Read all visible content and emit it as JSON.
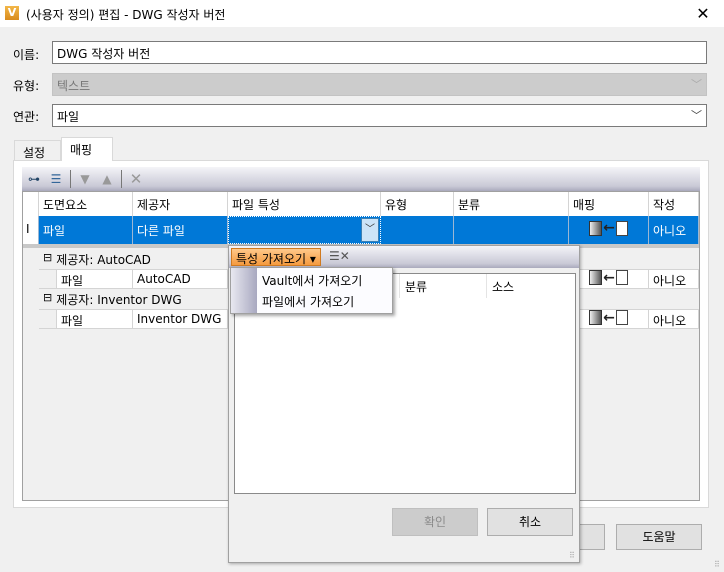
{
  "window": {
    "title": "(사용자 정의) 편집 - DWG 작성자 버전",
    "icon": "V",
    "close": "✕"
  },
  "form": {
    "name_label": "이름:",
    "name_value": "DWG 작성자 버전",
    "type_label": "유형:",
    "type_value": "텍스트",
    "assoc_label": "연관:",
    "assoc_value": "파일"
  },
  "tabs": [
    {
      "label": "설정"
    },
    {
      "label": "매핑"
    }
  ],
  "grid": {
    "headers": [
      "도면요소",
      "제공자",
      "파일 특성",
      "유형",
      "분류",
      "매핑",
      "작성"
    ],
    "selected_row": {
      "indicator": "I",
      "element": "파일",
      "provider": "다른 파일",
      "property": "",
      "type": "",
      "category": "",
      "write": "아니오"
    },
    "groups": [
      {
        "label": "제공자: AutoCAD",
        "row": {
          "element": "파일",
          "provider": "AutoCAD",
          "write": "아니오"
        }
      },
      {
        "label": "제공자: Inventor DWG",
        "row": {
          "element": "파일",
          "provider": "Inventor DWG",
          "write": "아니오"
        }
      }
    ]
  },
  "popup": {
    "get_button": "특성 가져오기 ▾",
    "columns": [
      "분류",
      "소스"
    ],
    "menu": [
      "Vault에서 가져오기",
      "파일에서 가져오기"
    ],
    "ok": "확인",
    "cancel": "취소"
  },
  "dialog": {
    "help": "도움말"
  }
}
